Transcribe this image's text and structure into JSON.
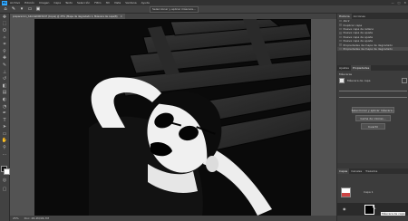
{
  "menu": {
    "items": [
      "Archivo",
      "Edición",
      "Imagen",
      "Capa",
      "Texto",
      "Selección",
      "Filtro",
      "3D",
      "Vista",
      "Ventana",
      "Ayuda"
    ]
  },
  "window_controls": {
    "minimize": "—",
    "maximize": "□",
    "close": "✕"
  },
  "options_bar": {
    "tool_icon": "home-icon",
    "chip1": "Seleccionar y aplicar máscara..."
  },
  "document": {
    "tab_title": "preparacion_tutorial00030.tif (Copia) @ 25% (Mapa de degradado 1, Máscara de capa/8)",
    "tab_close": "✕"
  },
  "status": {
    "zoom": "25%",
    "doc_info": "Doc: 48,4M/96,7M"
  },
  "panels": {
    "top_tabs": [
      "Historia",
      "Acciones"
    ],
    "history_items": [
      "Abrir",
      "Duplicar capa",
      "Nueva capa de relleno",
      "Nueva capa de ajuste",
      "Nueva capa de ajuste",
      "Nueva capa de ajuste",
      "Propiedades de mapa de degradado",
      "Propiedades de mapa de degradado"
    ],
    "mid_tabs": [
      "Ajustes",
      "Propiedades"
    ],
    "properties_title": "Máscaras",
    "properties_subtitle": "Máscara de capa",
    "mask_button": "Seleccionar y aplicar máscara...",
    "color_button": "Gama de colores...",
    "invert_button": "Invertir",
    "layers_tabs": [
      "Capas",
      "Canales",
      "Trazados"
    ],
    "layer_label": "Capa 1",
    "tooltip": "Máscara de capa"
  },
  "colors": {
    "accent": "#31a8ff",
    "ui_dark": "#323232",
    "panel": "#383838"
  }
}
